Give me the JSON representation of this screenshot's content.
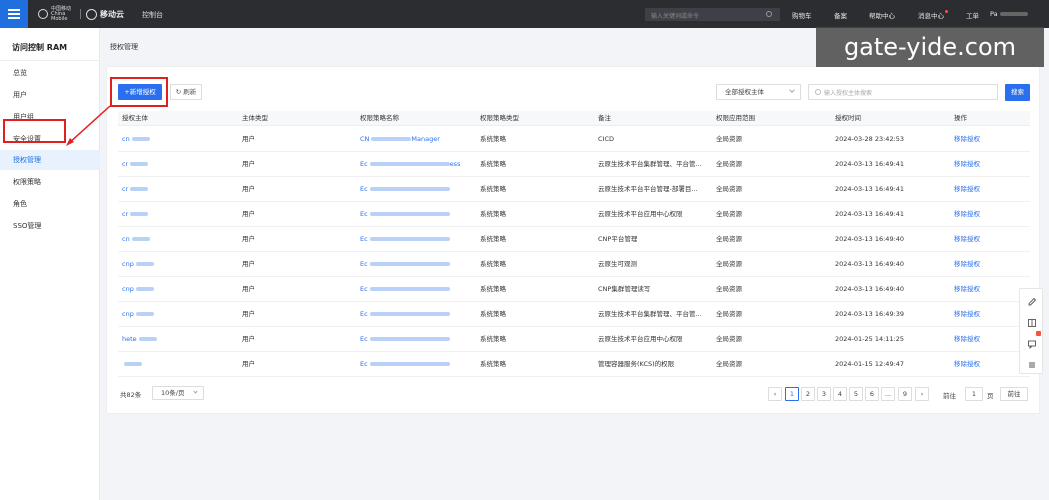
{
  "header": {
    "logo_primary": "中国移动",
    "logo_primary_en": "China Mobile",
    "logo_secondary": "移动云",
    "console": "控制台",
    "search_placeholder": "输入关键词或命令",
    "links": [
      "购物车",
      "备案",
      "帮助中心",
      "消息中心",
      "工单"
    ],
    "user": "Pa"
  },
  "sidebar": {
    "title": "访问控制 RAM",
    "items": [
      {
        "label": "总览"
      },
      {
        "label": "用户"
      },
      {
        "label": "用户组"
      },
      {
        "label": "安全设置"
      },
      {
        "label": "授权管理"
      },
      {
        "label": "权限策略"
      },
      {
        "label": "角色"
      },
      {
        "label": "SSO管理"
      }
    ]
  },
  "main": {
    "page_title": "授权管理",
    "new_button": "+新增授权",
    "refresh_button": "刷新",
    "filter_select": "全部授权主体",
    "search_placeholder": "输入授权主体搜索",
    "search_button": "搜索"
  },
  "table": {
    "columns": [
      "授权主体",
      "主体类型",
      "权限策略名称",
      "权限策略类型",
      "备注",
      "权限应用范围",
      "授权时间",
      "操作"
    ],
    "rows": [
      {
        "subject": "cn",
        "type": "用户",
        "policy": "CN",
        "policy_suffix": "Manager",
        "policy_type": "系统策略",
        "remark": "CICD",
        "scope": "全局资源",
        "time": "2024-03-28 23:42:53",
        "action": "移除授权"
      },
      {
        "subject": "cr",
        "type": "用户",
        "policy": "Ec",
        "policy_suffix": "ess",
        "policy_type": "系统策略",
        "remark": "云原生技术平台集群管理、平台管...",
        "scope": "全局资源",
        "time": "2024-03-13 16:49:41",
        "action": "移除授权"
      },
      {
        "subject": "cr",
        "type": "用户",
        "policy": "Ec",
        "policy_suffix": "",
        "policy_type": "系统策略",
        "remark": "云原生技术平台平台管理-部署目...",
        "scope": "全局资源",
        "time": "2024-03-13 16:49:41",
        "action": "移除授权"
      },
      {
        "subject": "cr",
        "type": "用户",
        "policy": "Ec",
        "policy_suffix": "",
        "policy_type": "系统策略",
        "remark": "云原生技术平台应用中心权限",
        "scope": "全局资源",
        "time": "2024-03-13 16:49:41",
        "action": "移除授权"
      },
      {
        "subject": "cn",
        "type": "用户",
        "policy": "Ec",
        "policy_suffix": "",
        "policy_type": "系统策略",
        "remark": "CNP平台管理",
        "scope": "全局资源",
        "time": "2024-03-13 16:49:40",
        "action": "移除授权"
      },
      {
        "subject": "cnp",
        "type": "用户",
        "policy": "Ec",
        "policy_suffix": "",
        "policy_type": "系统策略",
        "remark": "云原生可观测",
        "scope": "全局资源",
        "time": "2024-03-13 16:49:40",
        "action": "移除授权"
      },
      {
        "subject": "cnp",
        "type": "用户",
        "policy": "Ec",
        "policy_suffix": "",
        "policy_type": "系统策略",
        "remark": "CNP集群管理读写",
        "scope": "全局资源",
        "time": "2024-03-13 16:49:40",
        "action": "移除授权"
      },
      {
        "subject": "cnp",
        "type": "用户",
        "policy": "Ec",
        "policy_suffix": "",
        "policy_type": "系统策略",
        "remark": "云原生技术平台集群管理、平台管...",
        "scope": "全局资源",
        "time": "2024-03-13 16:49:39",
        "action": "移除授权"
      },
      {
        "subject": "hete",
        "type": "用户",
        "policy": "Ec",
        "policy_suffix": "",
        "policy_type": "系统策略",
        "remark": "云原生技术平台应用中心权限",
        "scope": "全局资源",
        "time": "2024-01-25 14:11:25",
        "action": "移除授权"
      },
      {
        "subject": "",
        "type": "用户",
        "policy": "Ec",
        "policy_suffix": "",
        "policy_type": "系统策略",
        "remark": "管理容器服务(KCS)的权限",
        "scope": "全局资源",
        "time": "2024-01-15 12:49:47",
        "action": "移除授权"
      }
    ]
  },
  "pagination": {
    "total": "共82条",
    "page_size": "10条/页",
    "prev": "‹",
    "pages": [
      "1",
      "2",
      "3",
      "4",
      "5",
      "6",
      "...",
      "9"
    ],
    "next": "›",
    "goto_label": "前往",
    "goto_value": "1",
    "goto_unit": "页",
    "goto_button": "前往"
  },
  "watermark": "gate-yide.com",
  "colors": {
    "accent": "#2a6ff0",
    "highlight": "#e02020",
    "topbar": "#2b2d31"
  }
}
